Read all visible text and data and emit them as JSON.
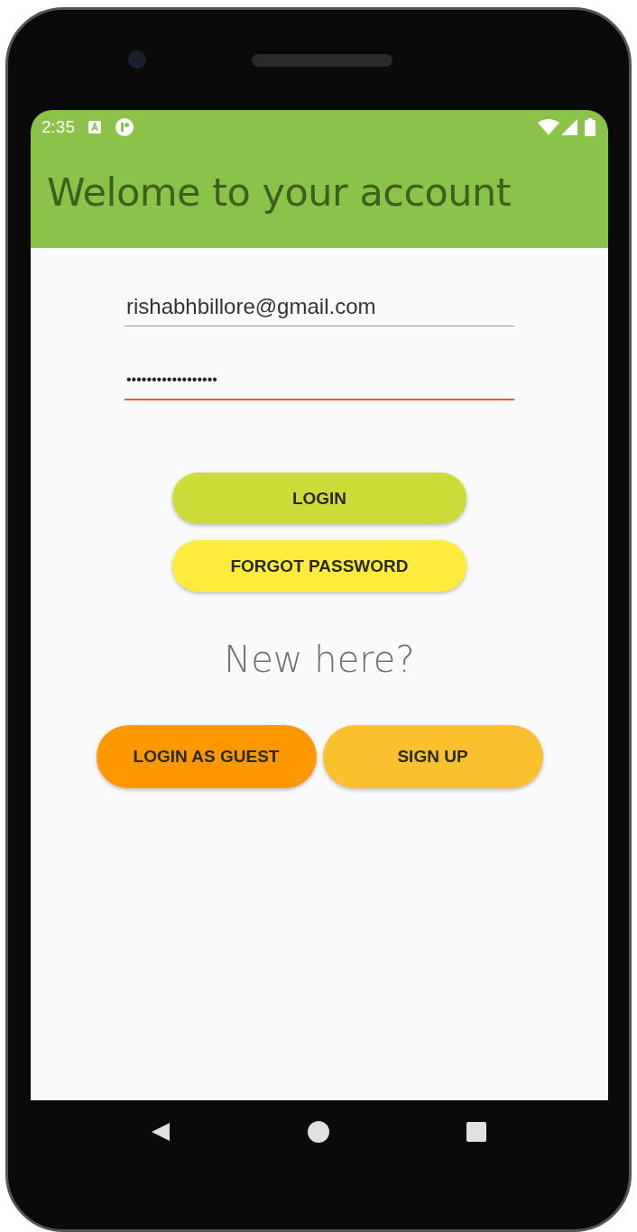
{
  "status_bar": {
    "time": "2:35"
  },
  "app_bar": {
    "title": "Welome to your account"
  },
  "fields": [
    {
      "kind": "email",
      "value": "rishabhbillore@gmail.com",
      "focused": false
    },
    {
      "kind": "password",
      "value": "••••••••••••••••••",
      "focused": true
    }
  ],
  "buttons": [
    {
      "label": "LOGIN",
      "color": "#cddc39"
    },
    {
      "label": "FORGOT PASSWORD",
      "color": "#ffeb3b"
    }
  ],
  "prompt": "New here?",
  "bottom_buttons": [
    {
      "label": "LOGIN AS GUEST",
      "color": "#ff9800"
    },
    {
      "label": "SIGN UP",
      "color": "#fbc02d"
    }
  ]
}
